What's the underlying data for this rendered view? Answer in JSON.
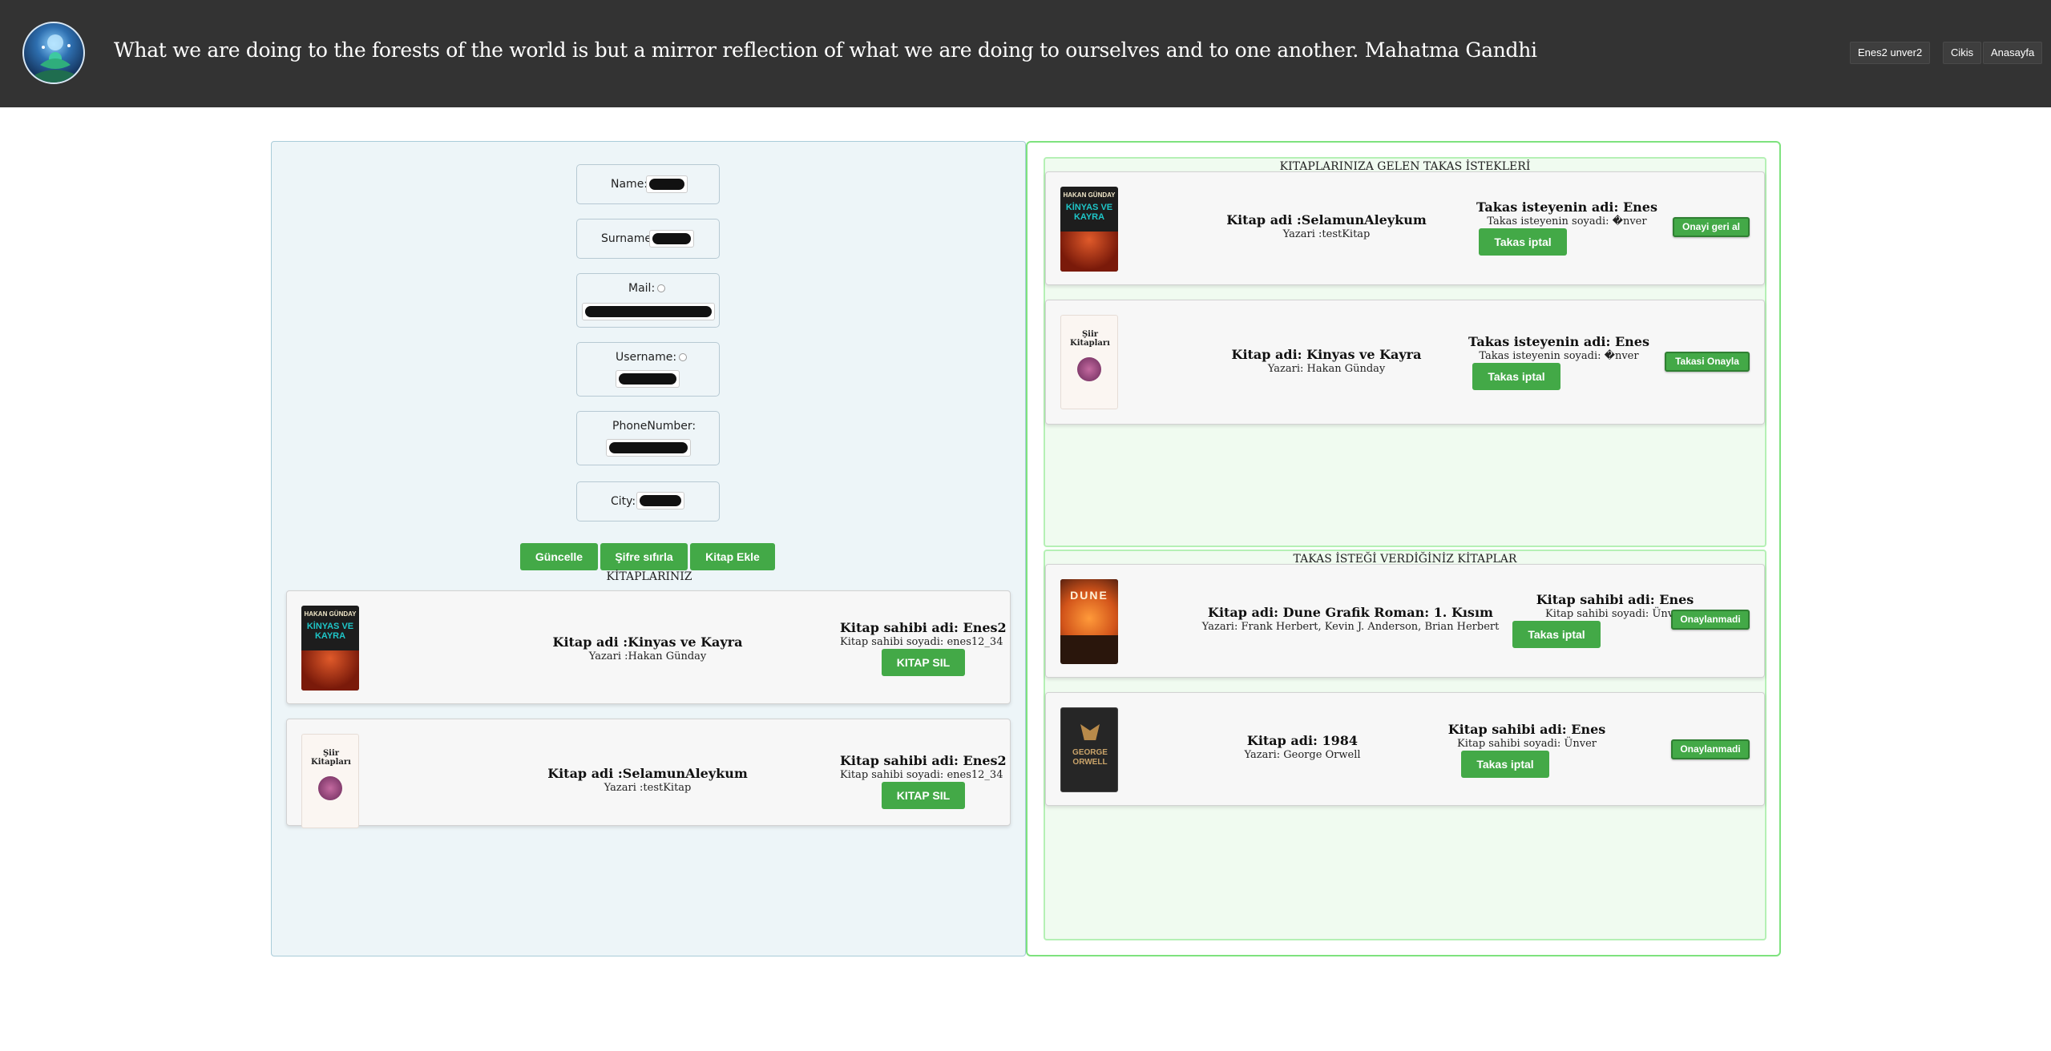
{
  "header": {
    "quote": "What we are doing to the forests of the world is but a mirror reflection of what we are doing to ourselves and to one another. Mahatma Gandhi",
    "user_button": "Enes2 unver2",
    "logout_button": "Cikis",
    "home_button": "Anasayfa"
  },
  "profile": {
    "name_label": "Name:",
    "surname_label": "Surname:",
    "mail_label": "Mail:",
    "username_label": "Username:",
    "phone_label": "PhoneNumber:",
    "city_label": "City:",
    "update_button": "Güncelle",
    "reset_password_button": "Şifre sıfırla",
    "add_book_button": "Kitap Ekle"
  },
  "my_books": {
    "title": "KİTAPLARINIZ",
    "items": [
      {
        "title": "Kitap adi :Kinyas ve Kayra",
        "author": "Yazari :Hakan Günday",
        "owner": "Kitap sahibi adi: Enes2",
        "owner_surname": "Kitap sahibi soyadi: enes12_34",
        "delete": "KITAP SIL"
      },
      {
        "title": "Kitap adi :SelamunAleykum",
        "author": "Yazari :testKitap",
        "owner": "Kitap sahibi adi: Enes2",
        "owner_surname": "Kitap sahibi soyadi: enes12_34",
        "delete": "KITAP SIL"
      }
    ]
  },
  "incoming": {
    "title": "KITAPLARINIZA GELEN TAKAS İSTEKLERİ",
    "items": [
      {
        "title": "Kitap adi :SelamunAleykum",
        "author": "Yazari :testKitap",
        "requester": "Takas isteyenin adi: Enes",
        "requester_surname": "Takas isteyenin soyadi: �nver",
        "cancel": "Takas iptal",
        "action": "Onayi geri al"
      },
      {
        "title": "Kitap adi: Kinyas ve Kayra",
        "author": "Yazari: Hakan Günday",
        "requester": "Takas isteyenin adi: Enes",
        "requester_surname": "Takas isteyenin soyadi: �nver",
        "cancel": "Takas iptal",
        "action": "Takasi Onayla"
      }
    ]
  },
  "outgoing": {
    "title": "TAKAS İSTEĞİ VERDİĞİNİZ KİTAPLAR",
    "items": [
      {
        "title": "Kitap adi: Dune Grafik Roman: 1. Kısım",
        "author": "Yazari: Frank Herbert, Kevin J. Anderson, Brian Herbert",
        "owner": "Kitap sahibi adi: Enes",
        "owner_surname": "Kitap sahibi soyadi: Ünver",
        "cancel": "Takas iptal",
        "status": "Onaylanmadi"
      },
      {
        "title": "Kitap adi: 1984",
        "author": "Yazari: George Orwell",
        "owner": "Kitap sahibi adi: Enes",
        "owner_surname": "Kitap sahibi soyadi: Ünver",
        "cancel": "Takas iptal",
        "status": "Onaylanmadi"
      }
    ]
  },
  "covers": {
    "kinyas_top": "HAKAN GÜNDAY",
    "kinyas_main": "KİNYAS VE KAYRA",
    "siir": "Şiir Kitapları",
    "dune": "DUNE",
    "orwell": "GEORGE ORWELL"
  },
  "colors": {
    "header_bg": "#333333",
    "button_green": "#43a947",
    "left_panel_bg": "#edf5f8",
    "right_panel_border": "#7ee27e"
  }
}
